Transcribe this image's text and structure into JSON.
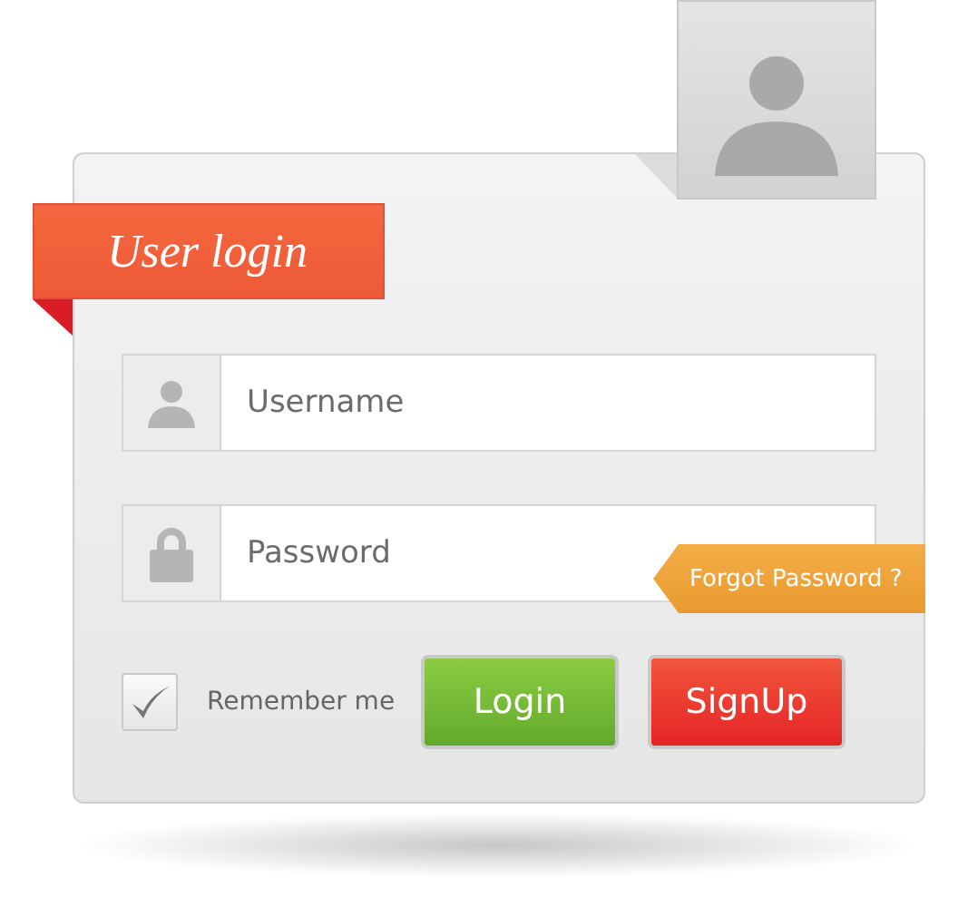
{
  "title": "User login",
  "username": {
    "placeholder": "Username"
  },
  "password": {
    "placeholder": "Password"
  },
  "forgot_link": "Forgot Password ?",
  "remember": {
    "label": "Remember me",
    "checked": true
  },
  "buttons": [
    {
      "label": "Login",
      "kind": "primary"
    },
    {
      "label": "SignUp",
      "kind": "danger"
    }
  ]
}
